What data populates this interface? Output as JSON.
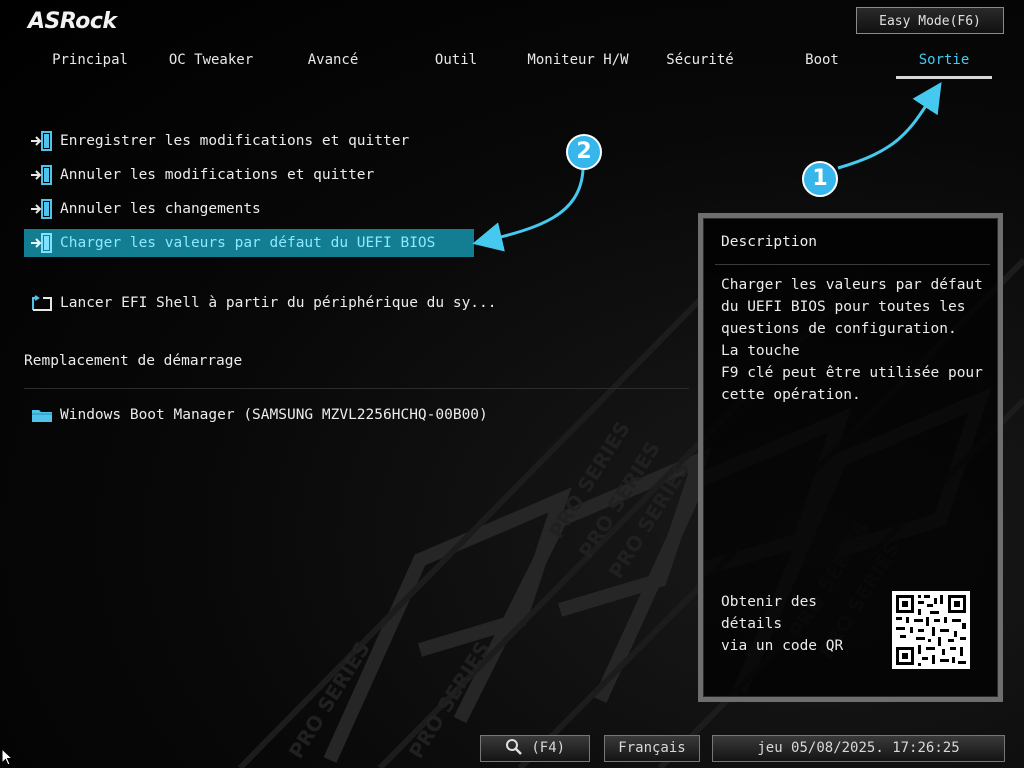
{
  "brand": {
    "logo_text": "ASRock"
  },
  "header": {
    "easy_mode_label": "Easy Mode(F6)"
  },
  "tabs": [
    {
      "label": "Principal"
    },
    {
      "label": "OC Tweaker"
    },
    {
      "label": "Avancé"
    },
    {
      "label": "Outil"
    },
    {
      "label": "Moniteur H/W"
    },
    {
      "label": "Sécurité"
    },
    {
      "label": "Boot"
    },
    {
      "label": "Sortie",
      "active": true
    }
  ],
  "menu": {
    "items": [
      {
        "label": "Enregistrer les modifications et quitter",
        "icon": "exit-door-icon"
      },
      {
        "label": "Annuler les modifications et quitter",
        "icon": "exit-door-icon"
      },
      {
        "label": "Annuler les changements",
        "icon": "exit-door-icon"
      },
      {
        "label": "Charger les valeurs par défaut du UEFI BIOS",
        "icon": "exit-door-icon",
        "selected": true
      },
      {
        "label": "Lancer EFI Shell à partir du périphérique du sy...",
        "icon": "shell-launch-icon"
      }
    ],
    "boot_override_title": "Remplacement de démarrage",
    "boot_items": [
      {
        "label": "Windows Boot Manager (SAMSUNG MZVL2256HCHQ-00B00)",
        "icon": "folder-icon"
      }
    ]
  },
  "description": {
    "title": "Description",
    "text": "Charger les valeurs par défaut\ndu UEFI BIOS pour toutes les\nquestions de configuration.\n La touche\nF9 clé peut être utilisée pour\ncette opération.",
    "qr_text": "Obtenir des détails\nvia un code QR"
  },
  "annotations": {
    "badge_1": "1",
    "badge_2": "2"
  },
  "footer": {
    "search_label": "(F4)",
    "language": "Français",
    "datetime": "jeu 05/08/2025. 17:26:25"
  },
  "colors": {
    "accent": "#45c9ee",
    "selected_bg": "#137d92",
    "badge": "#36b6ea"
  }
}
